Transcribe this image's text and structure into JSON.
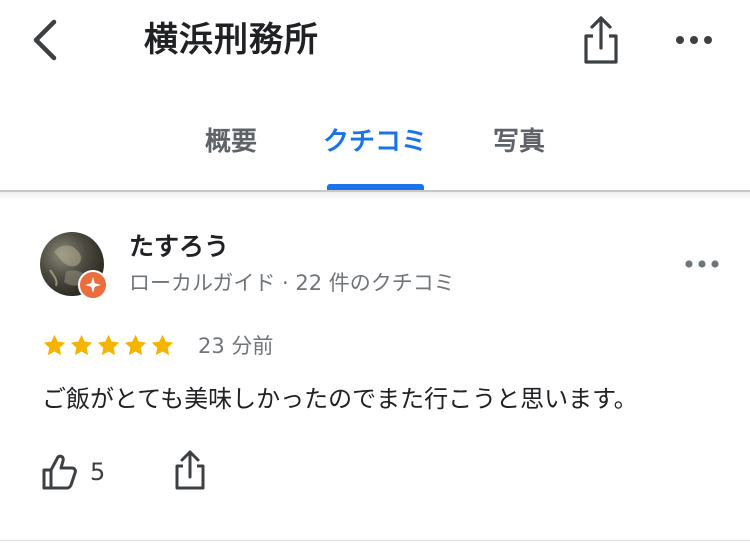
{
  "header": {
    "title": "横浜刑務所",
    "back_icon": "chevron-left-icon",
    "share_icon": "share-icon",
    "more_icon": "more-horizontal-icon"
  },
  "tabs": [
    {
      "label": "概要",
      "active": false
    },
    {
      "label": "クチコミ",
      "active": true
    },
    {
      "label": "写真",
      "active": false
    }
  ],
  "review": {
    "author": "たすろう",
    "meta": "ローカルガイド · 22 件のクチコミ",
    "rating": 5,
    "time": "23 分前",
    "text": "ご飯がとても美味しかったのでまた行こうと思います。",
    "likes": "5",
    "like_icon": "thumbs-up-icon",
    "share_icon": "share-icon",
    "more_icon": "more-horizontal-icon",
    "badge_icon": "local-guide-badge-icon"
  },
  "colors": {
    "accent": "#1a73e8",
    "star": "#f4b400",
    "badge": "#ea6d3d",
    "muted_text": "#70757a"
  }
}
